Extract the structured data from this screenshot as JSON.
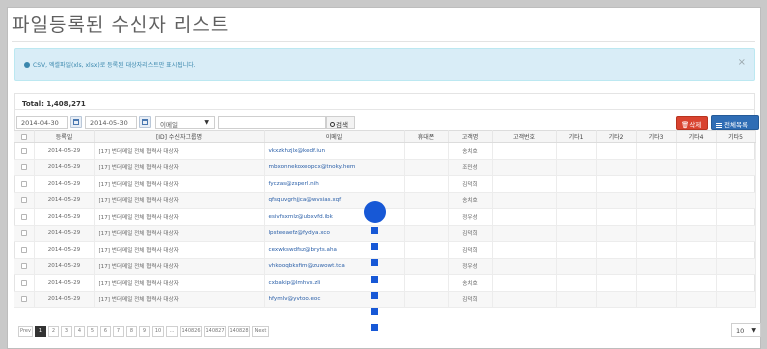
{
  "page": {
    "title": "파일등록된 수신자 리스트",
    "alert_text": "CSV, 엑셀파일(xls, xlsx)로 등록된 대상자리스트만 표시됩니다.",
    "alert_close": "×"
  },
  "toolbar": {
    "total_label": "Total: 1,408,271",
    "date_from": "2014-04-30",
    "date_to": "2014-05-30",
    "select_value": "이메일",
    "select_caret": "▼",
    "search_button": "검색",
    "delete_button": "삭제",
    "list_button": "전체목록"
  },
  "table": {
    "columns": [
      "",
      "등록일",
      "[ID] 수신자그룹명",
      "이메일",
      "휴대폰",
      "고객명",
      "고객번호",
      "기타1",
      "기타2",
      "기타3",
      "기타4",
      "기타5"
    ],
    "rows": [
      {
        "date": "2014-05-29",
        "group": "[17] 번더메일 전체 협력사 대상자",
        "email": "vkxzkhzjlx@kedf.iun",
        "phone": "",
        "name": "송치호"
      },
      {
        "date": "2014-05-29",
        "group": "[17] 번더메일 전체 협력사 대상자",
        "email": "mbxonnekoxeopcx@tnoky.hem",
        "phone": "",
        "name": "조민성"
      },
      {
        "date": "2014-05-29",
        "group": "[17] 번더메일 전체 협력사 대상자",
        "email": "fyczas@zsperl.nih",
        "phone": "",
        "name": "김덕희"
      },
      {
        "date": "2014-05-29",
        "group": "[17] 번더메일 전체 협력사 대상자",
        "email": "qfsquvgrhjjca@wvsias.xqf",
        "phone": "",
        "name": "송치호"
      },
      {
        "date": "2014-05-29",
        "group": "[17] 번더메일 전체 협력사 대상자",
        "email": "esivfsxmlz@ubxvfd.ibk",
        "phone": "",
        "name": "정우성"
      },
      {
        "date": "2014-05-29",
        "group": "[17] 번더메일 전체 협력사 대상자",
        "email": "lpsteeaefz@fydya.xco",
        "phone": "",
        "name": "김덕희"
      },
      {
        "date": "2014-05-29",
        "group": "[17] 번더메일 전체 협력사 대상자",
        "email": "cexwkswdfsz@bryts.aha",
        "phone": "",
        "name": "김덕희"
      },
      {
        "date": "2014-05-29",
        "group": "[17] 번더메일 전체 협력사 대상자",
        "email": "vhkooqbksfim@zuwowt.tca",
        "phone": "",
        "name": "정우성"
      },
      {
        "date": "2014-05-29",
        "group": "[17] 번더메일 전체 협력사 대상자",
        "email": "cxbakip@lmhvs.zli",
        "phone": "",
        "name": "송치호"
      },
      {
        "date": "2014-05-29",
        "group": "[17] 번더메일 전체 협력사 대상자",
        "email": "hfymlv@yvtoo.eoc",
        "phone": "",
        "name": "김덕희"
      }
    ]
  },
  "pagination": {
    "prev": "Prev",
    "pages": [
      "1",
      "2",
      "3",
      "4",
      "5",
      "6",
      "7",
      "8",
      "9",
      "10",
      "...",
      "140826",
      "140827",
      "140828"
    ],
    "next": "Next",
    "active_page": "1",
    "page_size": "10",
    "page_size_caret": "▼"
  },
  "colors": {
    "accent": "#2f6db5",
    "danger": "#d9432f",
    "alert_bg": "#d9edf7",
    "marker": "#1758d6"
  },
  "icons": {
    "alert": "info-circle-icon",
    "calendar": "calendar-icon",
    "search": "search-icon",
    "delete": "trash-icon",
    "list": "list-icon"
  }
}
